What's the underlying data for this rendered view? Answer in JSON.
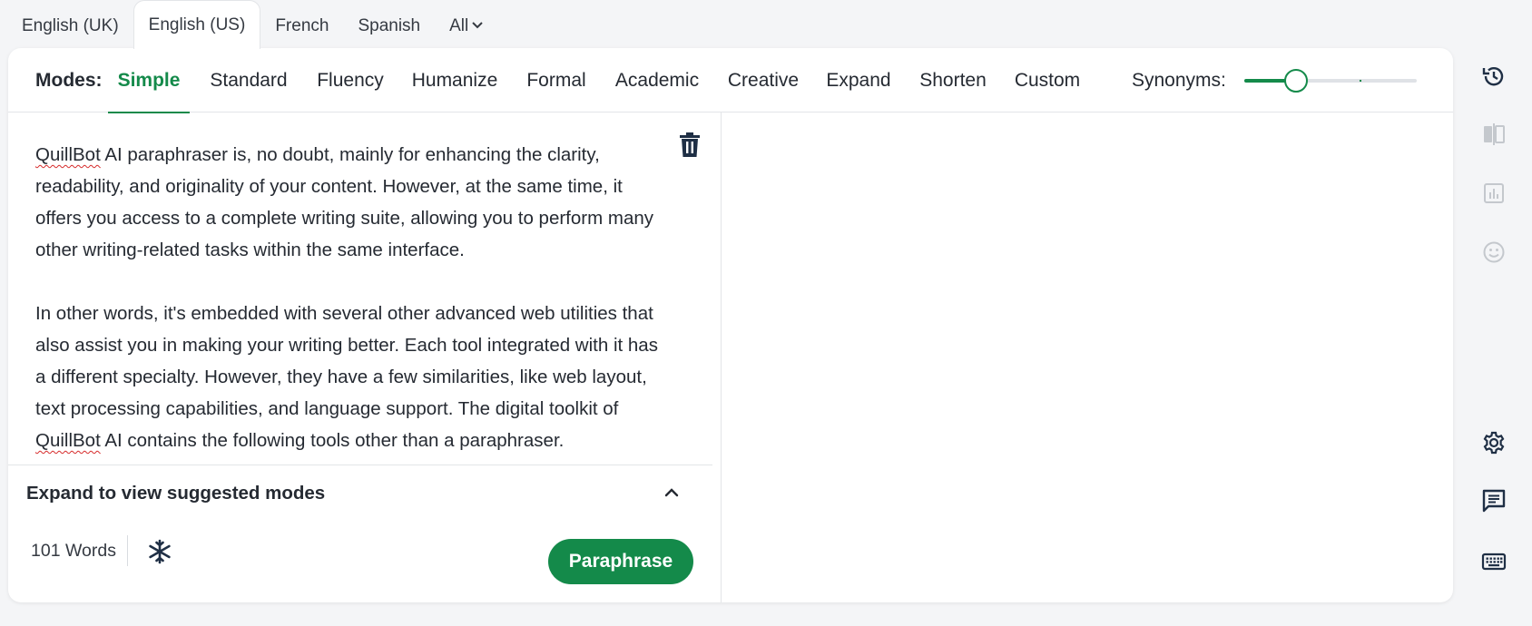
{
  "languages": {
    "tabs": [
      "English (UK)",
      "English (US)",
      "French",
      "Spanish",
      "All"
    ],
    "active": "English (US)"
  },
  "modes": {
    "label": "Modes:",
    "items": [
      "Simple",
      "Standard",
      "Fluency",
      "Humanize",
      "Formal",
      "Academic",
      "Creative",
      "Expand",
      "Shorten",
      "Custom"
    ],
    "active": "Simple"
  },
  "synonyms": {
    "label": "Synonyms:",
    "level": 0.3
  },
  "editor": {
    "paragraphs": [
      [
        "QuillBot",
        " AI paraphraser is, no doubt, mainly for enhancing the clarity, readability, and originality of your content. However, at the same time, it offers you access to a complete writing suite, allowing you to perform many other writing-related tasks within the same interface."
      ],
      [
        "In other words, it's embedded with several other advanced web utilities that also assist you in making your writing better. Each tool integrated with it has a different specialty. However, they have a few similarities, like web layout, text processing capabilities, and language support. The digital toolkit of ",
        "QuillBot",
        " AI contains the following tools other than a paraphraser."
      ]
    ]
  },
  "suggest": {
    "label": "Expand to view suggested modes"
  },
  "footer": {
    "word_count": "101 Words",
    "paraphrase_label": "Paraphrase"
  },
  "colors": {
    "accent": "#148a4a",
    "icon": "#1f2f45",
    "icon_disabled": "#c4c8cd"
  },
  "sidebar_icons": [
    "history-icon",
    "compare-icon",
    "stats-icon",
    "tone-icon",
    "settings-icon",
    "feedback-icon",
    "keyboard-icon"
  ]
}
